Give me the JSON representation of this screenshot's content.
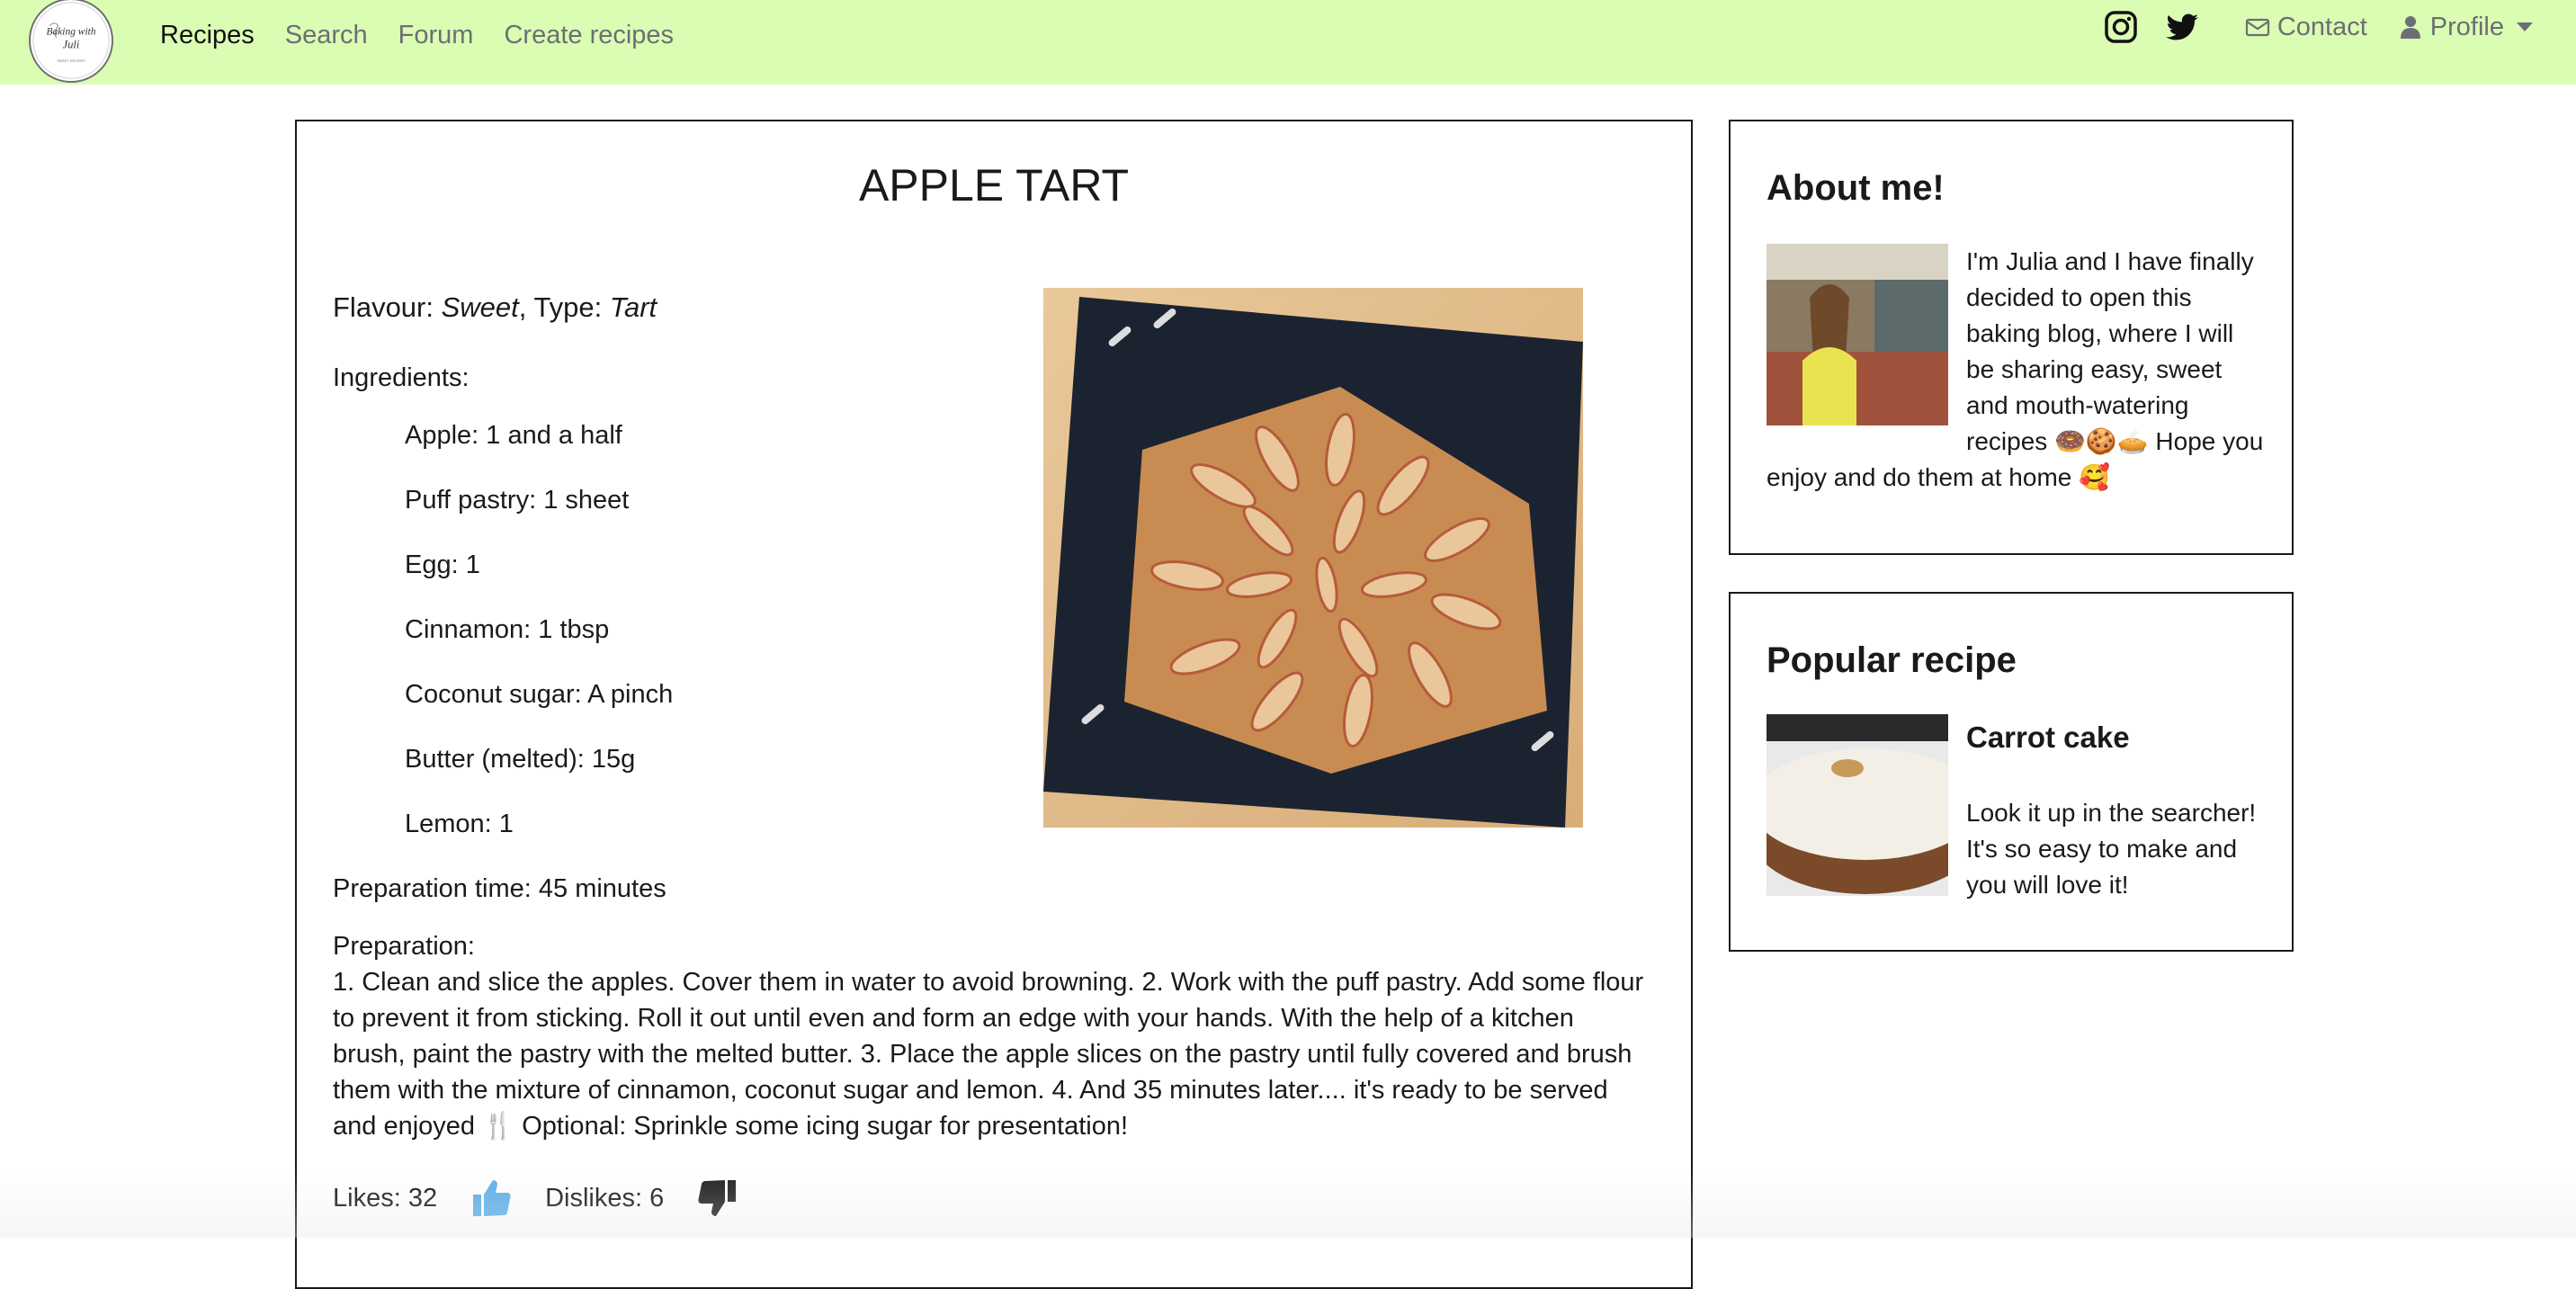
{
  "nav": {
    "logo_alt": "Baking with Juli",
    "links": [
      "Recipes",
      "Search",
      "Forum",
      "Create recipes"
    ],
    "active_index": 0,
    "contact_label": "Contact",
    "profile_label": "Profile",
    "bg_color": "#dbfdb3",
    "icons": [
      "instagram-icon",
      "twitter-icon",
      "envelope-icon",
      "user-icon"
    ]
  },
  "recipe": {
    "title": "APPLE TART",
    "flavour_label": "Flavour:",
    "flavour_value": "Sweet",
    "type_label": "Type:",
    "type_value": "Tart",
    "ingredients_label": "Ingredients:",
    "ingredients": [
      "Apple: 1 and a half",
      "Puff pastry: 1 sheet",
      "Egg: 1",
      "Cinnamon: 1 tbsp",
      "Coconut sugar: A pinch",
      "Butter (melted): 15g",
      "Lemon: 1"
    ],
    "prep_time": "Preparation time: 45 minutes",
    "preparation_label": "Preparation:",
    "preparation_text": "1. Clean and slice the apples. Cover them in water to avoid browning.  2. Work with the puff pastry. Add some flour to prevent it from sticking. Roll it out until even and form an edge with your hands. With the help of a kitchen brush, paint the pastry with the melted butter.  3. Place the apple slices on the pastry until fully covered and brush them with the mixture of cinnamon, coconut sugar and lemon.  4. And 35 minutes later.... it's ready to be served and enjoyed 🍴 Optional: Sprinkle some icing sugar for presentation!",
    "likes_label": "Likes: 32",
    "dislikes_label": "Dislikes: 6",
    "like_color": "#5fb0e8",
    "dislike_color": "#222222"
  },
  "about": {
    "title": "About me!",
    "text": "I'm Julia and I have finally decided to open this baking blog, where I will be sharing easy, sweet and mouth-watering recipes 🍩🍪🥧 Hope you enjoy and do them at home 🥰"
  },
  "popular": {
    "title": "Popular recipe",
    "name": "Carrot cake",
    "description": "Look it up in the searcher! It's so easy to make and you will love it!"
  }
}
